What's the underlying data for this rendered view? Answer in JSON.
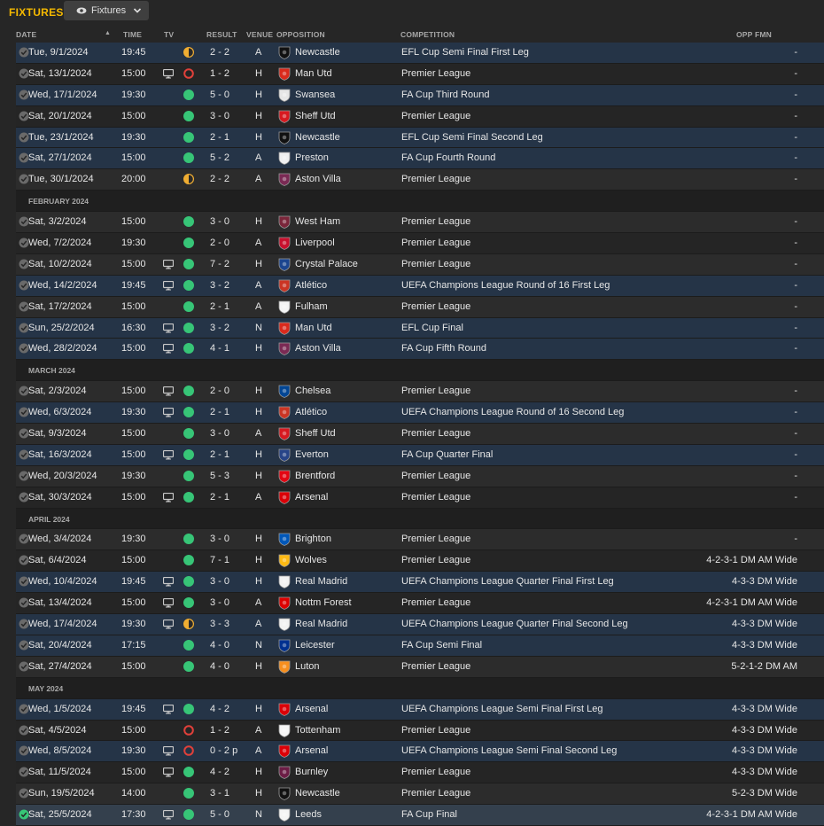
{
  "page": {
    "title": "FIXTURES",
    "view_label": "Fixtures"
  },
  "columns": {
    "date": "DATE",
    "time": "TIME",
    "tv": "TV",
    "result": "RESULT",
    "venue": "VENUE",
    "opposition": "OPPOSITION",
    "competition": "COMPETITION",
    "opp_fmn": "OPP FMN"
  },
  "colors": {
    "accent": "#f5b900",
    "win": "#37c577",
    "draw": "#f0ad32",
    "loss": "#e0403a",
    "row_highlight": "#253447",
    "row_selected": "#34404d"
  },
  "rows": [
    {
      "type": "fixture",
      "date": "Tue, 9/1/2024",
      "time": "19:45",
      "tv": false,
      "result": "draw",
      "score": "2 - 2",
      "venue": "A",
      "opposition": "Newcastle",
      "crest": "#111111",
      "competition": "EFL Cup Semi Final First Leg",
      "fmn": "-",
      "hl": true
    },
    {
      "type": "fixture",
      "date": "Sat, 13/1/2024",
      "time": "15:00",
      "tv": true,
      "result": "loss",
      "score": "1 - 2",
      "venue": "H",
      "opposition": "Man Utd",
      "crest": "#da2a1c",
      "competition": "Premier League",
      "fmn": "-",
      "hl": false
    },
    {
      "type": "fixture",
      "date": "Wed, 17/1/2024",
      "time": "19:30",
      "tv": false,
      "result": "win",
      "score": "5 - 0",
      "venue": "H",
      "opposition": "Swansea",
      "crest": "#e6e6e6",
      "competition": "FA Cup Third Round",
      "fmn": "-",
      "hl": true
    },
    {
      "type": "fixture",
      "date": "Sat, 20/1/2024",
      "time": "15:00",
      "tv": false,
      "result": "win",
      "score": "3 - 0",
      "venue": "H",
      "opposition": "Sheff Utd",
      "crest": "#d71920",
      "competition": "Premier League",
      "fmn": "-",
      "hl": false
    },
    {
      "type": "fixture",
      "date": "Tue, 23/1/2024",
      "time": "19:30",
      "tv": false,
      "result": "win",
      "score": "2 - 1",
      "venue": "H",
      "opposition": "Newcastle",
      "crest": "#111111",
      "competition": "EFL Cup Semi Final Second Leg",
      "fmn": "-",
      "hl": true
    },
    {
      "type": "fixture",
      "date": "Sat, 27/1/2024",
      "time": "15:00",
      "tv": false,
      "result": "win",
      "score": "5 - 2",
      "venue": "A",
      "opposition": "Preston",
      "crest": "#f0f0f0",
      "competition": "FA Cup Fourth Round",
      "fmn": "-",
      "hl": true
    },
    {
      "type": "fixture",
      "date": "Tue, 30/1/2024",
      "time": "20:00",
      "tv": false,
      "result": "draw",
      "score": "2 - 2",
      "venue": "A",
      "opposition": "Aston Villa",
      "crest": "#7a2a54",
      "competition": "Premier League",
      "fmn": "-",
      "hl": false
    },
    {
      "type": "month",
      "label": "FEBRUARY 2024"
    },
    {
      "type": "fixture",
      "date": "Sat, 3/2/2024",
      "time": "15:00",
      "tv": false,
      "result": "win",
      "score": "3 - 0",
      "venue": "H",
      "opposition": "West Ham",
      "crest": "#7a263a",
      "competition": "Premier League",
      "fmn": "-",
      "hl": false
    },
    {
      "type": "fixture",
      "date": "Wed, 7/2/2024",
      "time": "19:30",
      "tv": false,
      "result": "win",
      "score": "2 - 0",
      "venue": "A",
      "opposition": "Liverpool",
      "crest": "#c8102e",
      "competition": "Premier League",
      "fmn": "-",
      "hl": false
    },
    {
      "type": "fixture",
      "date": "Sat, 10/2/2024",
      "time": "15:00",
      "tv": true,
      "result": "win",
      "score": "7 - 2",
      "venue": "H",
      "opposition": "Crystal Palace",
      "crest": "#1b458f",
      "competition": "Premier League",
      "fmn": "-",
      "hl": false
    },
    {
      "type": "fixture",
      "date": "Wed, 14/2/2024",
      "time": "19:45",
      "tv": true,
      "result": "win",
      "score": "3 - 2",
      "venue": "A",
      "opposition": "Atlético",
      "crest": "#cb3524",
      "competition": "UEFA Champions League Round of 16 First Leg",
      "fmn": "-",
      "hl": true
    },
    {
      "type": "fixture",
      "date": "Sat, 17/2/2024",
      "time": "15:00",
      "tv": false,
      "result": "win",
      "score": "2 - 1",
      "venue": "A",
      "opposition": "Fulham",
      "crest": "#f5f5f5",
      "competition": "Premier League",
      "fmn": "-",
      "hl": false
    },
    {
      "type": "fixture",
      "date": "Sun, 25/2/2024",
      "time": "16:30",
      "tv": true,
      "result": "win",
      "score": "3 - 2",
      "venue": "N",
      "opposition": "Man Utd",
      "crest": "#da2a1c",
      "competition": "EFL Cup Final",
      "fmn": "-",
      "hl": true
    },
    {
      "type": "fixture",
      "date": "Wed, 28/2/2024",
      "time": "15:00",
      "tv": true,
      "result": "win",
      "score": "4 - 1",
      "venue": "H",
      "opposition": "Aston Villa",
      "crest": "#7a2a54",
      "competition": "FA Cup Fifth Round",
      "fmn": "-",
      "hl": true
    },
    {
      "type": "month",
      "label": "MARCH 2024"
    },
    {
      "type": "fixture",
      "date": "Sat, 2/3/2024",
      "time": "15:00",
      "tv": true,
      "result": "win",
      "score": "2 - 0",
      "venue": "H",
      "opposition": "Chelsea",
      "crest": "#034694",
      "competition": "Premier League",
      "fmn": "-",
      "hl": false
    },
    {
      "type": "fixture",
      "date": "Wed, 6/3/2024",
      "time": "19:30",
      "tv": true,
      "result": "win",
      "score": "2 - 1",
      "venue": "H",
      "opposition": "Atlético",
      "crest": "#cb3524",
      "competition": "UEFA Champions League Round of 16 Second Leg",
      "fmn": "-",
      "hl": true
    },
    {
      "type": "fixture",
      "date": "Sat, 9/3/2024",
      "time": "15:00",
      "tv": false,
      "result": "win",
      "score": "3 - 0",
      "venue": "A",
      "opposition": "Sheff Utd",
      "crest": "#d71920",
      "competition": "Premier League",
      "fmn": "-",
      "hl": false
    },
    {
      "type": "fixture",
      "date": "Sat, 16/3/2024",
      "time": "15:00",
      "tv": true,
      "result": "win",
      "score": "2 - 1",
      "venue": "H",
      "opposition": "Everton",
      "crest": "#274488",
      "competition": "FA Cup Quarter Final",
      "fmn": "-",
      "hl": true
    },
    {
      "type": "fixture",
      "date": "Wed, 20/3/2024",
      "time": "19:30",
      "tv": false,
      "result": "win",
      "score": "5 - 3",
      "venue": "H",
      "opposition": "Brentford",
      "crest": "#e30613",
      "competition": "Premier League",
      "fmn": "-",
      "hl": false
    },
    {
      "type": "fixture",
      "date": "Sat, 30/3/2024",
      "time": "15:00",
      "tv": true,
      "result": "win",
      "score": "2 - 1",
      "venue": "A",
      "opposition": "Arsenal",
      "crest": "#db0007",
      "competition": "Premier League",
      "fmn": "-",
      "hl": false
    },
    {
      "type": "month",
      "label": "APRIL 2024"
    },
    {
      "type": "fixture",
      "date": "Wed, 3/4/2024",
      "time": "19:30",
      "tv": false,
      "result": "win",
      "score": "3 - 0",
      "venue": "H",
      "opposition": "Brighton",
      "crest": "#0057b8",
      "competition": "Premier League",
      "fmn": "-",
      "hl": false
    },
    {
      "type": "fixture",
      "date": "Sat, 6/4/2024",
      "time": "15:00",
      "tv": false,
      "result": "win",
      "score": "7 - 1",
      "venue": "H",
      "opposition": "Wolves",
      "crest": "#fdb913",
      "competition": "Premier League",
      "fmn": "4-2-3-1 DM AM Wide",
      "hl": false
    },
    {
      "type": "fixture",
      "date": "Wed, 10/4/2024",
      "time": "19:45",
      "tv": true,
      "result": "win",
      "score": "3 - 0",
      "venue": "H",
      "opposition": "Real Madrid",
      "crest": "#f2f2f2",
      "competition": "UEFA Champions League Quarter Final First Leg",
      "fmn": "4-3-3 DM Wide",
      "hl": true
    },
    {
      "type": "fixture",
      "date": "Sat, 13/4/2024",
      "time": "15:00",
      "tv": true,
      "result": "win",
      "score": "3 - 0",
      "venue": "A",
      "opposition": "Nottm Forest",
      "crest": "#dd0000",
      "competition": "Premier League",
      "fmn": "4-2-3-1 DM AM Wide",
      "hl": false
    },
    {
      "type": "fixture",
      "date": "Wed, 17/4/2024",
      "time": "19:30",
      "tv": true,
      "result": "draw",
      "score": "3 - 3",
      "venue": "A",
      "opposition": "Real Madrid",
      "crest": "#f2f2f2",
      "competition": "UEFA Champions League Quarter Final Second Leg",
      "fmn": "4-3-3 DM Wide",
      "hl": true
    },
    {
      "type": "fixture",
      "date": "Sat, 20/4/2024",
      "time": "17:15",
      "tv": false,
      "result": "win",
      "score": "4 - 0",
      "venue": "N",
      "opposition": "Leicester",
      "crest": "#003090",
      "competition": "FA Cup Semi Final",
      "fmn": "4-3-3 DM Wide",
      "hl": true
    },
    {
      "type": "fixture",
      "date": "Sat, 27/4/2024",
      "time": "15:00",
      "tv": false,
      "result": "win",
      "score": "4 - 0",
      "venue": "H",
      "opposition": "Luton",
      "crest": "#f78f1e",
      "competition": "Premier League",
      "fmn": "5-2-1-2 DM AM",
      "hl": false
    },
    {
      "type": "month",
      "label": "MAY 2024"
    },
    {
      "type": "fixture",
      "date": "Wed, 1/5/2024",
      "time": "19:45",
      "tv": true,
      "result": "win",
      "score": "4 - 2",
      "venue": "H",
      "opposition": "Arsenal",
      "crest": "#db0007",
      "competition": "UEFA Champions League Semi Final First Leg",
      "fmn": "4-3-3 DM Wide",
      "hl": true
    },
    {
      "type": "fixture",
      "date": "Sat, 4/5/2024",
      "time": "15:00",
      "tv": false,
      "result": "loss",
      "score": "1 - 2",
      "venue": "A",
      "opposition": "Tottenham",
      "crest": "#f5f5f5",
      "competition": "Premier League",
      "fmn": "4-3-3 DM Wide",
      "hl": false
    },
    {
      "type": "fixture",
      "date": "Wed, 8/5/2024",
      "time": "19:30",
      "tv": true,
      "result": "loss",
      "score": "0 - 2 p",
      "venue": "A",
      "opposition": "Arsenal",
      "crest": "#db0007",
      "competition": "UEFA Champions League Semi Final Second Leg",
      "fmn": "4-3-3 DM Wide",
      "hl": true
    },
    {
      "type": "fixture",
      "date": "Sat, 11/5/2024",
      "time": "15:00",
      "tv": true,
      "result": "win",
      "score": "4 - 2",
      "venue": "H",
      "opposition": "Burnley",
      "crest": "#6c1d45",
      "competition": "Premier League",
      "fmn": "4-3-3 DM Wide",
      "hl": false
    },
    {
      "type": "fixture",
      "date": "Sun, 19/5/2024",
      "time": "14:00",
      "tv": false,
      "result": "win",
      "score": "3 - 1",
      "venue": "H",
      "opposition": "Newcastle",
      "crest": "#111111",
      "competition": "Premier League",
      "fmn": "5-2-3 DM Wide",
      "hl": false
    },
    {
      "type": "fixture",
      "date": "Sat, 25/5/2024",
      "time": "17:30",
      "tv": true,
      "result": "win",
      "score": "5 - 0",
      "venue": "N",
      "opposition": "Leeds",
      "crest": "#f5f5f5",
      "competition": "FA Cup Final",
      "fmn": "4-2-3-1 DM AM Wide",
      "hl": true,
      "selected": true
    }
  ]
}
